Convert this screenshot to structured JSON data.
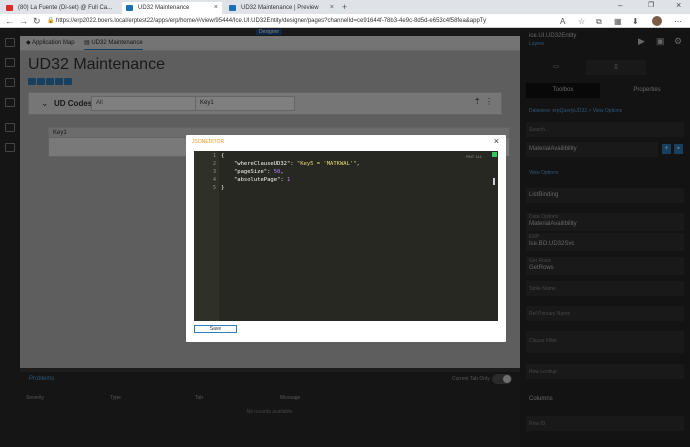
{
  "browser": {
    "tabs": [
      {
        "label": "(80) La Fuente (Di-set) @ Full Ca...",
        "icon": "youtube-icon",
        "color": "#e02a2a"
      },
      {
        "label": "UD32 Maintenance",
        "icon": "epicor-icon",
        "color": "#1b6fb5"
      },
      {
        "label": "UD32 Maintenance | Preview",
        "icon": "epicor-icon",
        "color": "#1b6fb5"
      }
    ],
    "url": "https://erp2022.boers.local/erptest22/apps/erp/home/#/view/95444/Ice.UI.UD32Entity/designer/pages?channelId=ce91644f-78b3-4e9c-8d5d-e653c4f58fea&appType=view&subA...",
    "lock_symbol": "🔒"
  },
  "designer": {
    "badge": "Designer",
    "page_tabs": [
      "Application Map",
      "UD32 Maintenance"
    ],
    "page_title": "UD32 Maintenance",
    "panel": {
      "title": "UD Codes",
      "select_value": "All",
      "key_input_value": "Key1",
      "grid_header": "Key1"
    }
  },
  "problems": {
    "title": "Problems",
    "toggle_label": "Current Tab Only",
    "columns": [
      "Severity",
      "Type",
      "Tab",
      "Message"
    ],
    "empty": "No records available."
  },
  "properties": {
    "header_line1": "ice.UI.UD32Entity",
    "header_line2": "Layers",
    "tabs": [
      "Toolbox",
      "Properties"
    ],
    "breadcrumb": "Dataview: erpQuerlyUD32 > View Options",
    "search_placeholder": "Search...",
    "selected_item": "MaterialAvailibility",
    "section": "View Options",
    "fields": [
      {
        "label": "",
        "value": "ListBinding"
      },
      {
        "label": "Data Options",
        "value": "MaterialAvailibility"
      },
      {
        "label": "ERP",
        "value": "Ice.BO.UD32Svc"
      },
      {
        "label": "Get Rows",
        "value": "GetRows"
      },
      {
        "label": "",
        "value": "Table Name"
      },
      {
        "label": "",
        "value": "Ref Primary Name"
      },
      {
        "label": "",
        "value": "Clause Filter"
      },
      {
        "label": "",
        "value": "Row Lookup"
      }
    ],
    "columns_section": "Columns",
    "last_field": "Row ID"
  },
  "modal": {
    "title": "JSONEDITOR",
    "close": "×",
    "editor_badge": "RNT 114",
    "lines": [
      {
        "num": "1",
        "text": "{"
      },
      {
        "num": "2",
        "key": "\"whereClauseUD32\"",
        "value": "\"Key5 = 'MATKWAL'\"",
        "sep": ","
      },
      {
        "num": "3",
        "key": "\"pageSize\"",
        "value": "50",
        "sep": ","
      },
      {
        "num": "4",
        "key": "\"absolutePage\"",
        "value": "1",
        "sep": ""
      },
      {
        "num": "5",
        "text": "}"
      }
    ],
    "save_label": "Save"
  },
  "colors": {
    "accent": "#2e7fbf",
    "modal_title": "#e89b1c",
    "editor_bg": "#272822"
  }
}
